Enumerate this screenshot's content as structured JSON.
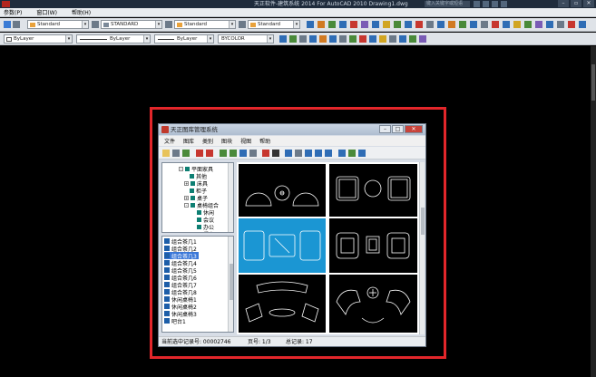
{
  "acad": {
    "title": "天正软件-建筑系统 2014  For AutoCAD 2010     Drawing1.dwg",
    "search_placeholder": "键入关键字或短语"
  },
  "menubar": {
    "items": [
      "参数(P)",
      "窗口(W)",
      "帮助(H)"
    ]
  },
  "toolbar1": {
    "textstyle": "Standard",
    "dimstyle": "STANDARD",
    "tablestyle": "Standard",
    "mleaderstyle": "Standard"
  },
  "toolbar2": {
    "layer": "ByLayer",
    "linetype": "ByLayer",
    "lineweight": "ByLayer",
    "plotstyle": "BYCOLOR"
  },
  "dialog": {
    "title": "天正图库管理系统",
    "menu": [
      "文件",
      "图库",
      "类别",
      "图块",
      "视图",
      "帮助"
    ],
    "tree": [
      {
        "label": "平面家具",
        "level": 0
      },
      {
        "label": "其他",
        "level": 1
      },
      {
        "label": "床具",
        "level": 1
      },
      {
        "label": "柜子",
        "level": 1
      },
      {
        "label": "桌子",
        "level": 1
      },
      {
        "label": "桌椅组合",
        "level": 1
      },
      {
        "label": "休闲",
        "level": 2
      },
      {
        "label": "会议",
        "level": 2
      },
      {
        "label": "办公",
        "level": 2
      },
      {
        "label": "餐桌",
        "level": 2
      }
    ],
    "list": [
      "组合茶几1",
      "组合茶几2",
      "组合茶几3",
      "组合茶几4",
      "组合茶几5",
      "组合茶几6",
      "组合茶几7",
      "组合茶几8",
      "休闲桌椅1",
      "休闲桌椅2",
      "休闲桌椅3",
      "吧台1"
    ],
    "list_selected": 2,
    "status": {
      "record": "当前选中记录号: 00002746",
      "page": "页号: 1/3",
      "total": "总记录: 17"
    }
  }
}
